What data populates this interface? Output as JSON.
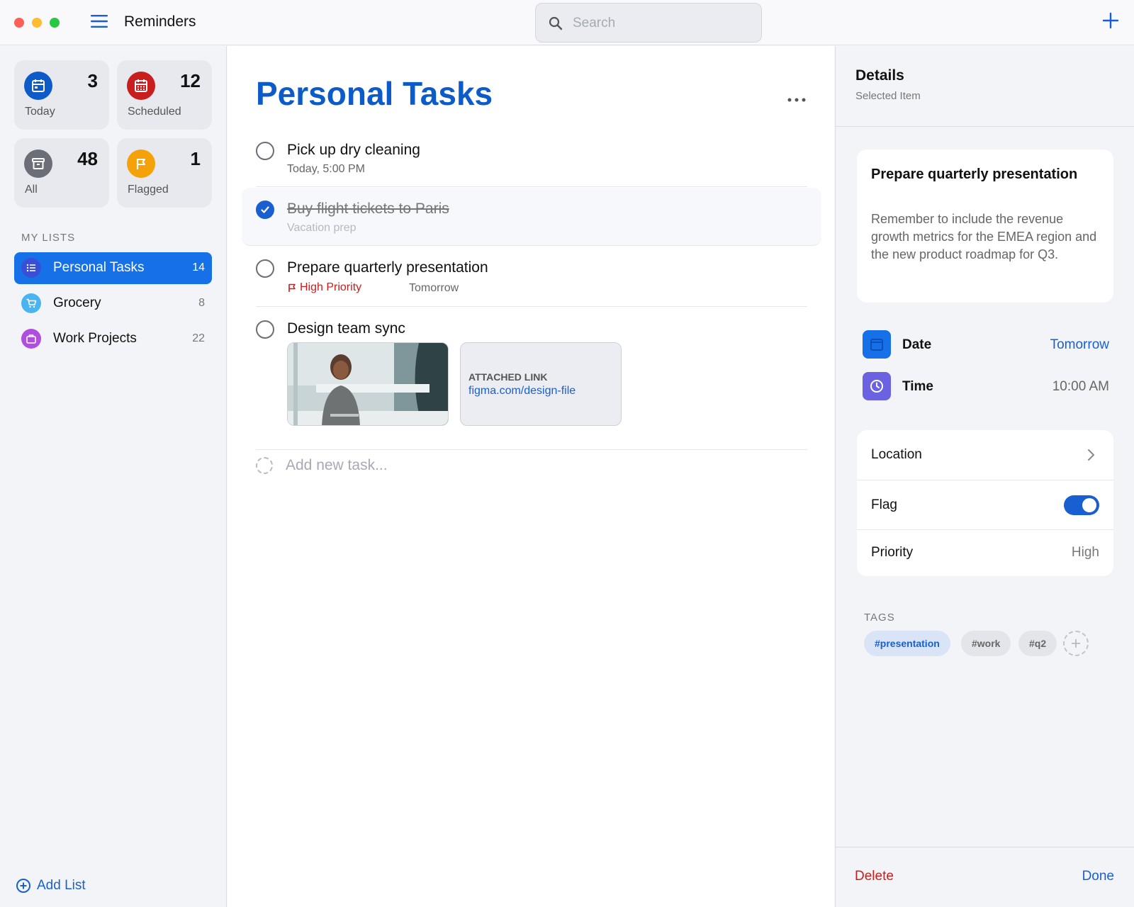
{
  "app": {
    "title": "Reminders"
  },
  "search": {
    "placeholder": "Search"
  },
  "smart_lists": [
    {
      "label": "Today",
      "count": "3",
      "icon": "calendar-icon",
      "color": "#0d5bc9"
    },
    {
      "label": "Scheduled",
      "count": "12",
      "icon": "calendar-grid-icon",
      "color": "#c81e1e"
    },
    {
      "label": "All",
      "count": "48",
      "icon": "tray-icon",
      "color": "#6b6e77"
    },
    {
      "label": "Flagged",
      "count": "1",
      "icon": "flag-icon",
      "color": "#f5a20a"
    }
  ],
  "my_lists": {
    "heading": "MY LISTS",
    "items": [
      {
        "label": "Personal Tasks",
        "count": "14",
        "icon": "list-icon",
        "color": "#3a4fd8",
        "active": true
      },
      {
        "label": "Grocery",
        "count": "8",
        "icon": "cart-icon",
        "color": "#4ab4f0"
      },
      {
        "label": "Work Projects",
        "count": "22",
        "icon": "briefcase-icon",
        "color": "#b04ee0"
      }
    ]
  },
  "add_list_label": "Add List",
  "main": {
    "title": "Personal Tasks",
    "tasks": [
      {
        "title": "Pick up dry cleaning",
        "subtitle": "Today, 5:00 PM",
        "completed": false
      },
      {
        "title": "Buy flight tickets to Paris",
        "subtitle": "Vacation prep",
        "completed": true
      },
      {
        "title": "Prepare quarterly presentation",
        "priority": "High Priority",
        "date": "Tomorrow",
        "completed": false
      },
      {
        "title": "Design team sync",
        "completed": false,
        "attachment": {
          "label": "ATTACHED LINK",
          "url": "figma.com/design-file"
        }
      }
    ],
    "add_task_placeholder": "Add new task..."
  },
  "details": {
    "title": "Details",
    "subtitle": "Selected Item",
    "note_title": "Prepare quarterly presentation",
    "note_body": "Remember to include the revenue growth metrics for the EMEA region and the new product roadmap for Q3.",
    "date_label": "Date",
    "date_value": "Tomorrow",
    "time_label": "Time",
    "time_value": "10:00 AM",
    "location_label": "Location",
    "flag_label": "Flag",
    "flag_on": true,
    "priority_label": "Priority",
    "priority_value": "High",
    "tags_label": "TAGS",
    "tags": [
      "#presentation",
      "#work",
      "#q2"
    ],
    "delete_label": "Delete",
    "done_label": "Done"
  },
  "colors": {
    "accent": "#1a5fd1",
    "title_blue": "#0d5bc9",
    "danger": "#c81e1e"
  }
}
